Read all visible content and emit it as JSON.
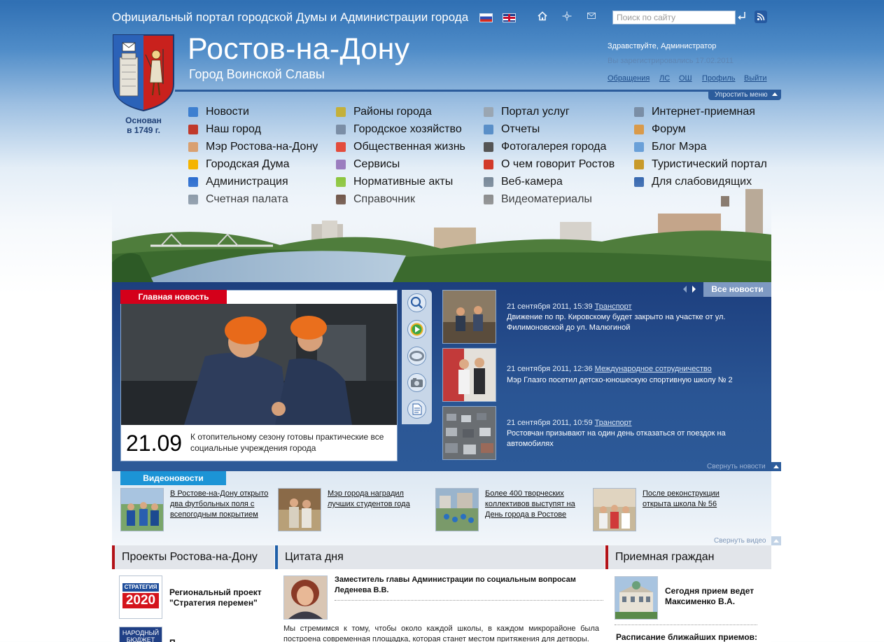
{
  "header": {
    "portal_title": "Официальный портал городской Думы и Администрации города",
    "search_placeholder": "Поиск по сайту",
    "city_name": "Ростов-на-Дону",
    "city_slogan": "Город Воинской Славы",
    "founded_line1": "Основан",
    "founded_line2": "в 1749 г.",
    "simplify_menu": "Упростить меню",
    "icons": [
      "flag-ru",
      "flag-en",
      "home-icon",
      "sitemap-icon",
      "mail-icon",
      "enter-icon",
      "rss-icon"
    ]
  },
  "user": {
    "greeting": "Здравствуйте, Администратор",
    "registered": "Вы зарегистрировались 17.02.2011",
    "links": [
      "Обращения",
      "ЛС",
      "ОШ",
      "Профиль",
      "Выйти"
    ]
  },
  "menu": {
    "col1": [
      "Новости",
      "Наш город",
      "Мэр Ростова-на-Дону",
      "Городская Дума",
      "Администрация",
      "Счетная палата"
    ],
    "col2": [
      "Районы города",
      "Городское хозяйство",
      "Общественная жизнь",
      "Сервисы",
      "Нормативные акты",
      "Справочник"
    ],
    "col3": [
      "Портал услуг",
      "Отчеты",
      "Фотогалерея города",
      "О чем говорит Ростов",
      "Веб-камера",
      "Видеоматериалы"
    ],
    "col4": [
      "Интернет-приемная",
      "Форум",
      "Блог Мэра",
      "Туристический портал",
      "Для слабовидящих"
    ],
    "icon_colors": [
      "#3d7fd0",
      "#c0392b",
      "#d9a070",
      "#f4b400",
      "#2e6fd0",
      "#7a8a9a",
      "#c4b03a",
      "#7b8ea6",
      "#e34c3c",
      "#9b7dbf",
      "#8dc63f",
      "#5a3a2a",
      "#9aa6b2",
      "#5a8fc8",
      "#555555",
      "#d23a2a",
      "#7a8a9a",
      "#7a7a7a",
      "#7a8ea6",
      "#d99a4a",
      "#6aa0d8",
      "#c89a2a",
      "#3a6ab0"
    ]
  },
  "main_news": {
    "tab": "Главная новость",
    "date": "21.09",
    "text": "К отопительному сезону готовы практические все социальные учреждения города"
  },
  "news": {
    "all_news": "Все новости",
    "collapse": "Свернуть новости",
    "items": [
      {
        "meta": "21 сентября 2011, 15:39",
        "category": "Транспорт",
        "text": "Движение по пр. Кировскому будет закрыто на участке от ул. Филимоновской до ул. Малюгиной"
      },
      {
        "meta": "21 сентября 2011, 12:36",
        "category": "Международное сотрудничество",
        "text": "Мэр Глазго посетил детско-юношескую спортивную школу № 2"
      },
      {
        "meta": "21 сентября 2011, 10:59",
        "category": "Транспорт",
        "text": "Ростовчан призывают на один день отказаться от поездок на автомобилях"
      }
    ]
  },
  "video": {
    "tab": "Видеоновости",
    "collapse": "Свернуть видео",
    "items": [
      "В Ростове-на-Дону открыто два футбольных поля с всепогодным покрытием",
      "Мэр города наградил лучших студентов года",
      "Более 400 творческих коллективов выступят на День города в Ростове",
      "После реконструкции открыта школа № 56"
    ]
  },
  "sections": {
    "projects": {
      "title": "Проекты Ростова-на-Дону",
      "strategy_logo_line1": "СТРАТЕГИЯ",
      "strategy_logo_line2": "2020",
      "strategy_text": "Региональный проект \"Стратегия перемен\"",
      "budget_logo": "НАРОДНЫЙ БЮДЖЕТ",
      "budget_text": "П"
    },
    "quote": {
      "title": "Цитата дня",
      "author": "Заместитель главы Администрации по социальным вопросам Леденева В.В.",
      "text": "Мы стремимся к тому, чтобы около каждой школы, в каждом микрорайоне была построена современная площадка, которая станет местом притяжения для детворы."
    },
    "reception": {
      "title": "Приемная граждан",
      "today": "Сегодня прием ведет Максименко В.А.",
      "schedule": "Расписание ближайших приемов:"
    }
  }
}
